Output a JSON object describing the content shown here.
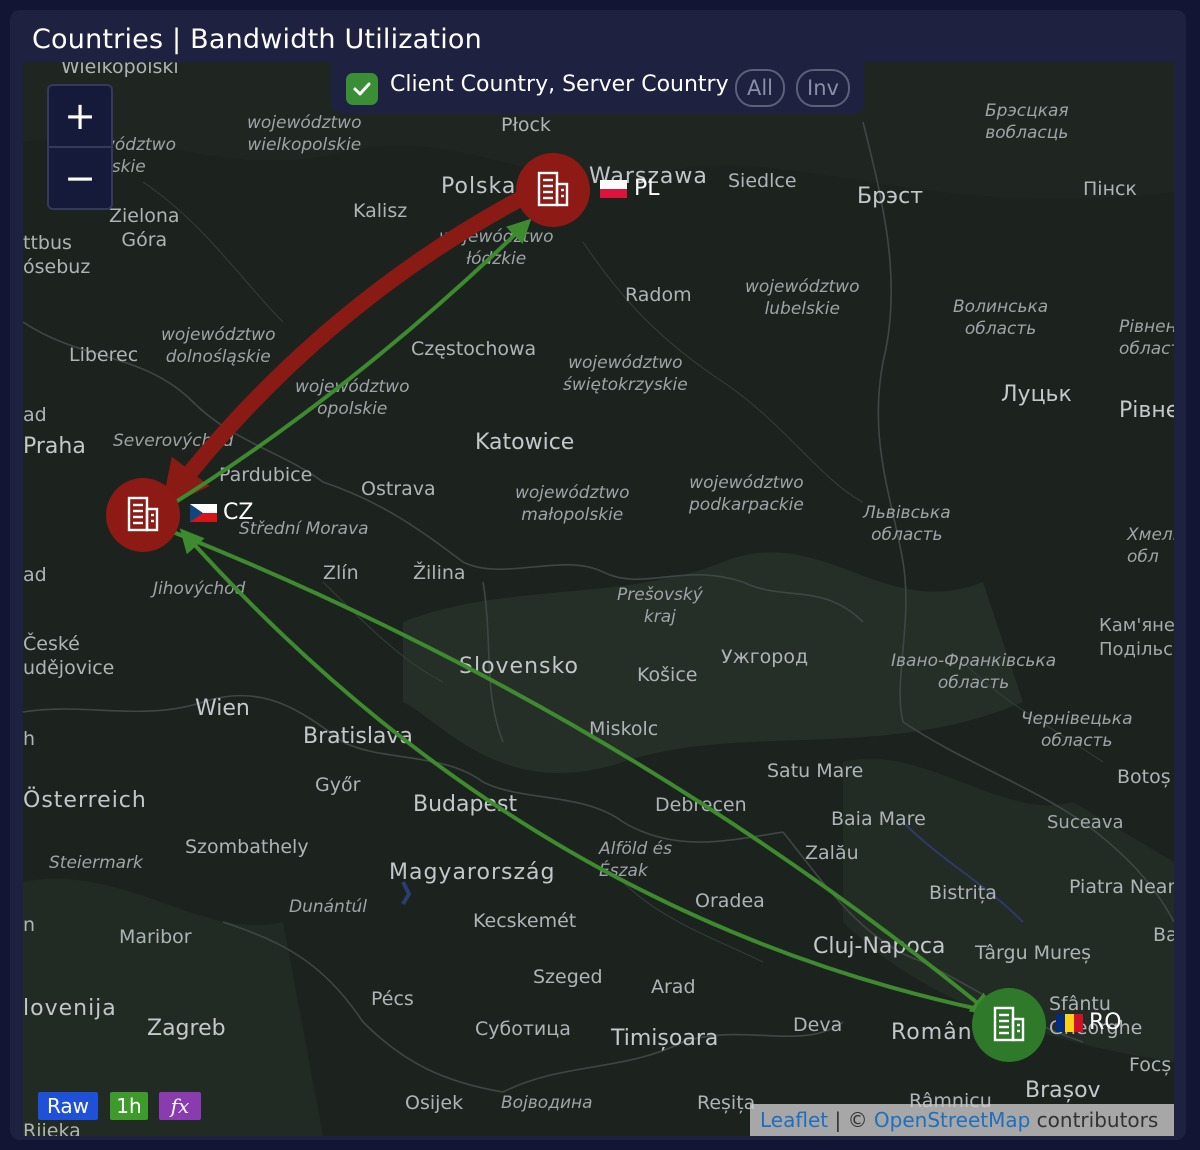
{
  "panel": {
    "title": "Countries | Bandwidth Utilization"
  },
  "filter": {
    "label": "Client Country, Server Country",
    "all_label": "All",
    "inv_label": "Inv",
    "checked": true
  },
  "zoom": {
    "in_label": "+",
    "out_label": "−"
  },
  "nodes": {
    "pl": {
      "code": "PL",
      "color": "#8e1a16"
    },
    "cz": {
      "code": "CZ",
      "color": "#8e1a16"
    },
    "ro": {
      "code": "RO",
      "color": "#2e7a2a"
    }
  },
  "flow_colors": {
    "heavy": "#8a1a14",
    "light": "#3e8a2e"
  },
  "badges": {
    "raw": "Raw",
    "interval": "1h",
    "fx": "fx"
  },
  "badge_colors": {
    "raw": "#1f50d8",
    "interval": "#3f9a2c",
    "fx": "#8a3bb0"
  },
  "attribution": {
    "leaflet": "Leaflet",
    "separator": " | © ",
    "osm": "OpenStreetMap",
    "suffix": " contributors"
  },
  "map_labels": {
    "wielkopolski": "Wielkopolski",
    "woj_wielkopolskie": "województwo\nwielkopolskie",
    "plock": "Płock",
    "polska": "Polska",
    "warszawa": "Warszawa",
    "siedlce": "Siedlce",
    "brest": "Брэст",
    "pinsk": "Пінск",
    "brestskaya": "Брэсцкая\nвобласць",
    "wodztwo_left": "wództwo\nuskie",
    "zielona_gora": "Zielona\nGóra",
    "ttbus": "ttbus",
    "osebuz": "ósebuz",
    "kalisz": "Kalisz",
    "woj_lodzkie": "województwo\nłódzkie",
    "radom": "Radom",
    "woj_lubelskie": "województwo\nlubelskie",
    "volynska": "Волинська\nобласть",
    "rivnenska": "Рівненс\nобласт",
    "liberec": "Liberec",
    "woj_dolnoslaskie": "województwo\ndolnośląskie",
    "czestochowa": "Częstochowa",
    "woj_swietokrzyskie": "województwo\nświętokrzyskie",
    "lutsk": "Луцьк",
    "rivne": "Рівне",
    "woj_opolskie": "województwo\nopolskie",
    "ad_left": "ad",
    "praha": "Praha",
    "severovychod": "Severovýchod",
    "katowice": "Katowice",
    "ostrava": "Ostrava",
    "woj_malopolskie": "województwo\nmałopolskie",
    "woj_podkarpackie": "województwo\npodkarpackie",
    "lvivska": "Львівська\nобласть",
    "khmelnytska": "Хмель\nобл",
    "pardubice": "Pardubice",
    "stredni_morava": "Střední Morava",
    "ad_left2": "ad",
    "zlin": "Zlín",
    "zilina": "Žilina",
    "jihovychod": "Jihovýchod",
    "presovsky": "Prešovský\nkraj",
    "kamianets": "Кам'яне\nПодільсь",
    "ceske": "České\nudějovice",
    "slovensko": "Slovensko",
    "uzhhorod": "Ужгород",
    "kosice": "Košice",
    "ivano": "Івано-Франківська\nобласть",
    "wien": "Wien",
    "bratislava": "Bratislava",
    "miskolc": "Miskolc",
    "chernivetska": "Чернівецька\nобласть",
    "h_left": "h",
    "satu_mare": "Satu Mare",
    "botosani": "Botoș",
    "osterreich": "Österreich",
    "gyor": "Győr",
    "budapest": "Budapest",
    "debrecen": "Debrecen",
    "baia_mare": "Baia Mare",
    "suceava": "Suceava",
    "steiermark": "Steiermark",
    "szombathely": "Szombathely",
    "alfold": "Alföld és\nÉszak",
    "zalau": "Zalău",
    "magyarorszag": "Magyarország",
    "bistrita": "Bistrița",
    "piatra_neamt": "Piatra Neam",
    "dunantul": "Dunántúl",
    "oradea": "Oradea",
    "n_left": "n",
    "kecskemet": "Kecskemét",
    "maribor": "Maribor",
    "cluj": "Cluj-Napoca",
    "targu_mures": "Târgu Mureș",
    "ba_right": "Ba",
    "szeged": "Szeged",
    "arad": "Arad",
    "sfantu": "Sfântu\nGheorghe",
    "lovenija": "lovenija",
    "pecs": "Pécs",
    "zagreb": "Zagreb",
    "subotica": "Суботица",
    "timisoara": "Timișoara",
    "deva": "Deva",
    "romania": "România",
    "focsani": "Focș",
    "osijek": "Osijek",
    "vojvodina": "Војводина",
    "resita": "Reșița",
    "brasov": "Brașov",
    "ramnicu": "Râmnicu",
    "rijeka": "Rijeka"
  }
}
